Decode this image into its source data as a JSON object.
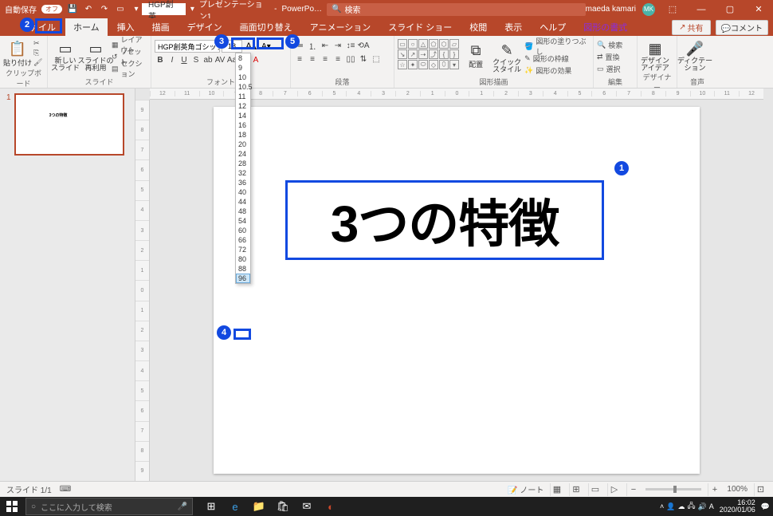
{
  "titlebar": {
    "autosave_label": "自動保存",
    "autosave_toggle": "オフ",
    "font_quick": "HGP創英",
    "doc_name": "プレゼンテーション1",
    "app_name": "PowerPo…",
    "search_placeholder": "検索",
    "user_name": "maeda kamari",
    "user_initials": "MK"
  },
  "tabs": {
    "file": "ファイル",
    "home": "ホーム",
    "insert": "挿入",
    "draw": "描画",
    "design": "デザイン",
    "transition": "画面切り替え",
    "animation": "アニメーション",
    "slideshow": "スライド ショー",
    "review": "校閲",
    "view": "表示",
    "help": "ヘルプ",
    "shape_format": "図形の書式",
    "share": "共有",
    "comment": "コメント"
  },
  "ribbon": {
    "clipboard": {
      "paste": "貼り付け",
      "label": "クリップボード"
    },
    "slides": {
      "new_slide": "新しい\nスライド",
      "reuse": "スライドの\n再利用",
      "layout": "レイアウト",
      "reset": "リセット",
      "section": "セクション",
      "label": "スライド"
    },
    "font": {
      "name": "HGP創英角ゴシックUB",
      "size": "18",
      "label": "フォント"
    },
    "paragraph": {
      "label": "段落"
    },
    "drawing": {
      "arrange": "配置",
      "quick_style": "クイック\nスタイル",
      "shape_fill": "図形の塗りつぶし",
      "shape_outline": "図形の枠線",
      "shape_effects": "図形の効果",
      "label": "図形描画"
    },
    "editing": {
      "find": "検索",
      "replace": "置換",
      "select": "選択",
      "label": "編集"
    },
    "designer": {
      "btn": "デザイン\nアイデア",
      "label": "デザイナー"
    },
    "voice": {
      "dictate": "ディクテー\nション",
      "label": "音声"
    }
  },
  "font_sizes": [
    "8",
    "9",
    "10",
    "10.5",
    "11",
    "12",
    "14",
    "16",
    "18",
    "20",
    "24",
    "28",
    "32",
    "36",
    "40",
    "44",
    "48",
    "54",
    "60",
    "66",
    "72",
    "80",
    "88",
    "96"
  ],
  "thumb": {
    "num": "1",
    "text": "3つの特徴"
  },
  "slide": {
    "text": "3つの特徴"
  },
  "ruler_h": [
    "12",
    "11",
    "10",
    "9",
    "8",
    "7",
    "6",
    "5",
    "4",
    "3",
    "2",
    "1",
    "0",
    "1",
    "2",
    "3",
    "4",
    "5",
    "6",
    "7",
    "8",
    "9",
    "10",
    "11",
    "12"
  ],
  "ruler_v": [
    "9",
    "8",
    "7",
    "6",
    "5",
    "4",
    "3",
    "2",
    "1",
    "0",
    "1",
    "2",
    "3",
    "4",
    "5",
    "6",
    "7",
    "8",
    "9"
  ],
  "status": {
    "slide": "スライド 1/1",
    "lang_icon": "⌨",
    "notes": "ノート",
    "zoom": "100%"
  },
  "taskbar": {
    "search_placeholder": "ここに入力して検索",
    "time": "16:02",
    "date": "2020/01/06"
  },
  "annotations": {
    "a1": "1",
    "a2": "2",
    "a3": "3",
    "a4": "4",
    "a5": "5"
  }
}
